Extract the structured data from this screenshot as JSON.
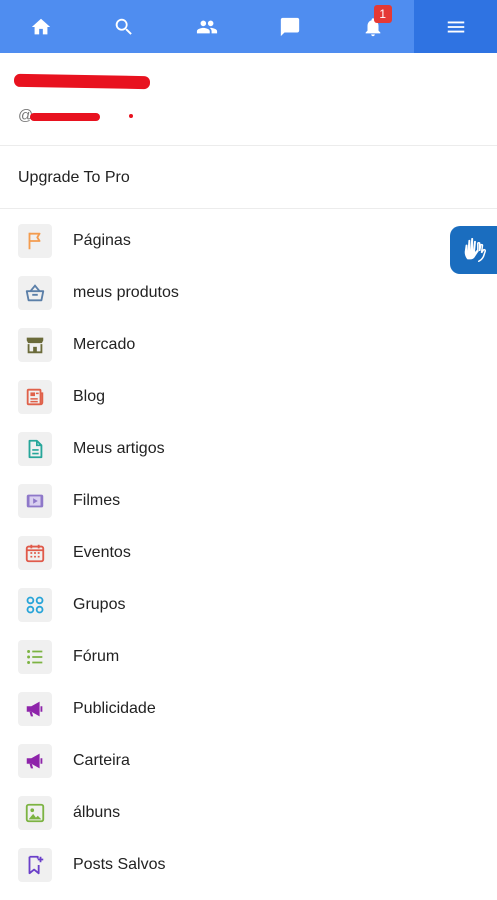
{
  "navbar": {
    "items": [
      {
        "name": "home",
        "icon": "home-icon"
      },
      {
        "name": "search",
        "icon": "search-icon"
      },
      {
        "name": "friends",
        "icon": "people-icon"
      },
      {
        "name": "messages",
        "icon": "chat-icon"
      },
      {
        "name": "notifications",
        "icon": "bell-icon",
        "badge": "1"
      },
      {
        "name": "menu",
        "icon": "hamburger-menu-icon",
        "active": true
      }
    ],
    "notification_badge": "1",
    "color": "#4f8df0",
    "active_color": "#2f73e2"
  },
  "profile": {
    "name": "",
    "handle": "@"
  },
  "upgrade": {
    "label": "Upgrade To Pro"
  },
  "menu": {
    "items": [
      {
        "label": "Páginas",
        "icon": "flag-icon",
        "color": "#f39c4f"
      },
      {
        "label": "meus produtos",
        "icon": "basket-icon",
        "color": "#5b7fa8"
      },
      {
        "label": "Mercado",
        "icon": "store-icon",
        "color": "#6b6b3a"
      },
      {
        "label": "Blog",
        "icon": "newspaper-icon",
        "color": "#e0614a"
      },
      {
        "label": "Meus artigos",
        "icon": "document-icon",
        "color": "#26a69a"
      },
      {
        "label": "Filmes",
        "icon": "video-icon",
        "color": "#8e78c9"
      },
      {
        "label": "Eventos",
        "icon": "calendar-icon",
        "color": "#e05a4a"
      },
      {
        "label": "Grupos",
        "icon": "groups-icon",
        "color": "#27a4d8"
      },
      {
        "label": "Fórum",
        "icon": "list-icon",
        "color": "#7cb342"
      },
      {
        "label": "Publicidade",
        "icon": "megaphone-icon",
        "color": "#8e24aa"
      },
      {
        "label": "Carteira",
        "icon": "megaphone-icon",
        "color": "#8e24aa"
      },
      {
        "label": "álbuns",
        "icon": "image-icon",
        "color": "#7cb342"
      },
      {
        "label": "Posts Salvos",
        "icon": "bookmark-icon",
        "color": "#6a3fc9"
      }
    ]
  },
  "accessibility_button": {
    "icon": "sign-language-hands-icon",
    "color": "#1a6dbf"
  }
}
